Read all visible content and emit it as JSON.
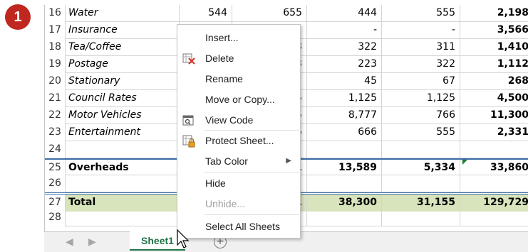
{
  "step_badge": "1",
  "rows": [
    {
      "num": "16",
      "a": "Water",
      "b": "544",
      "c": "655",
      "d": "444",
      "e": "555",
      "f": "2,198",
      "style": ""
    },
    {
      "num": "17",
      "a": "Insurance",
      "b": "",
      "c": "",
      "d": "-",
      "e": "-",
      "f": "3,566",
      "style": ""
    },
    {
      "num": "18",
      "a": "Tea/Coffee",
      "b": "",
      "c": "3",
      "d": "322",
      "e": "311",
      "f": "1,410",
      "style": ""
    },
    {
      "num": "19",
      "a": "Postage",
      "b": "",
      "c": "3",
      "d": "223",
      "e": "322",
      "f": "1,112",
      "style": ""
    },
    {
      "num": "20",
      "a": "Stationary",
      "b": "",
      "c": "",
      "d": "45",
      "e": "67",
      "f": "268",
      "style": ""
    },
    {
      "num": "21",
      "a": "Council Rates",
      "b": "",
      "c": "5",
      "d": "1,125",
      "e": "1,125",
      "f": "4,500",
      "style": ""
    },
    {
      "num": "22",
      "a": "Motor Vehicles",
      "b": "",
      "c": "5",
      "d": "8,777",
      "e": "766",
      "f": "11,300",
      "style": ""
    },
    {
      "num": "23",
      "a": "Entertainment",
      "b": "",
      "c": "5",
      "d": "666",
      "e": "555",
      "f": "2,331",
      "style": ""
    },
    {
      "num": "24",
      "a": "",
      "b": "",
      "c": "",
      "d": "",
      "e": "",
      "f": "",
      "style": ""
    },
    {
      "num": "25",
      "a": "Overheads",
      "b": "",
      "c": "1",
      "d": "13,589",
      "e": "5,334",
      "f": "33,860",
      "style": "bold blue-top"
    },
    {
      "num": "26",
      "a": "",
      "b": "",
      "c": "",
      "d": "",
      "e": "",
      "f": "",
      "style": ""
    },
    {
      "num": "27",
      "a": "Total",
      "b": "",
      "c": "1",
      "d": "38,300",
      "e": "31,155",
      "f": "129,729",
      "style": "bold total double-top"
    },
    {
      "num": "28",
      "a": "",
      "b": "",
      "c": "",
      "d": "",
      "e": "",
      "f": "",
      "style": ""
    }
  ],
  "tabbar": {
    "prev_icon": "◀",
    "next_icon": "▶",
    "sheet_tab": "Sheet1",
    "add_sheet": "+"
  },
  "context_menu": {
    "items": [
      {
        "label": "Insert...",
        "icon": "",
        "disabled": false
      },
      {
        "label": "Delete",
        "icon": "delete-sheet-icon",
        "disabled": false
      },
      {
        "label": "Rename",
        "icon": "",
        "disabled": false
      },
      {
        "label": "Move or Copy...",
        "icon": "",
        "disabled": false
      },
      {
        "label": "View Code",
        "icon": "view-code-icon",
        "disabled": false
      },
      {
        "label": "Protect Sheet...",
        "icon": "protect-sheet-icon",
        "disabled": false
      },
      {
        "label": "Tab Color",
        "icon": "",
        "disabled": false,
        "submenu": true
      },
      {
        "label": "Hide",
        "icon": "",
        "disabled": false
      },
      {
        "label": "Unhide...",
        "icon": "",
        "disabled": true
      },
      {
        "label": "Select All Sheets",
        "icon": "",
        "disabled": false
      }
    ]
  },
  "colors": {
    "badge": "#c0271e",
    "total_fill": "#d8e4bc",
    "sheet_tab_text": "#217346",
    "border_blue": "#3d6fa8"
  }
}
